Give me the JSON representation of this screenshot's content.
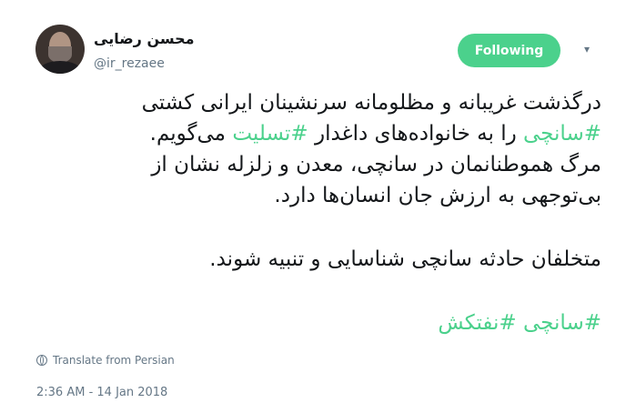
{
  "tweet": {
    "display_name": "محسن رضایی",
    "handle": "@ir_rezaee",
    "follow_label": "Following",
    "lines": [
      [
        {
          "text": "درگذشت غریبانه و مظلومانه سرنشینان ایرانی کشتی ",
          "hashtag": false
        }
      ],
      [
        {
          "text": "#سانچی",
          "hashtag": true
        },
        {
          "text": " را به خانواده‌های داغدار ",
          "hashtag": false
        },
        {
          "text": "#تسلیت",
          "hashtag": true
        },
        {
          "text": " می‌گویم.",
          "hashtag": false
        }
      ],
      [
        {
          "text": "مرگ هموطنانمان در سانچی، معدن و زلزله نشان از",
          "hashtag": false
        }
      ],
      [
        {
          "text": "بی‌توجهی به ارزش جان انسان‌ها دارد.",
          "hashtag": false
        }
      ],
      [],
      [
        {
          "text": "متخلفان حادثه سانچی شناسایی و تنبیه شوند.",
          "hashtag": false
        }
      ],
      [],
      [
        {
          "text": "#سانچی",
          "hashtag": true
        },
        {
          "text": " ",
          "hashtag": false
        },
        {
          "text": "#نفتکش",
          "hashtag": true
        }
      ]
    ],
    "translate_label": "Translate from Persian",
    "timestamp": "2:36 AM - 14 Jan 2018"
  },
  "colors": {
    "accent": "#4bd18c",
    "muted": "#657786",
    "text": "#14171a"
  },
  "icons": {
    "caret": "chevron-down-icon",
    "translate": "globe-icon"
  }
}
